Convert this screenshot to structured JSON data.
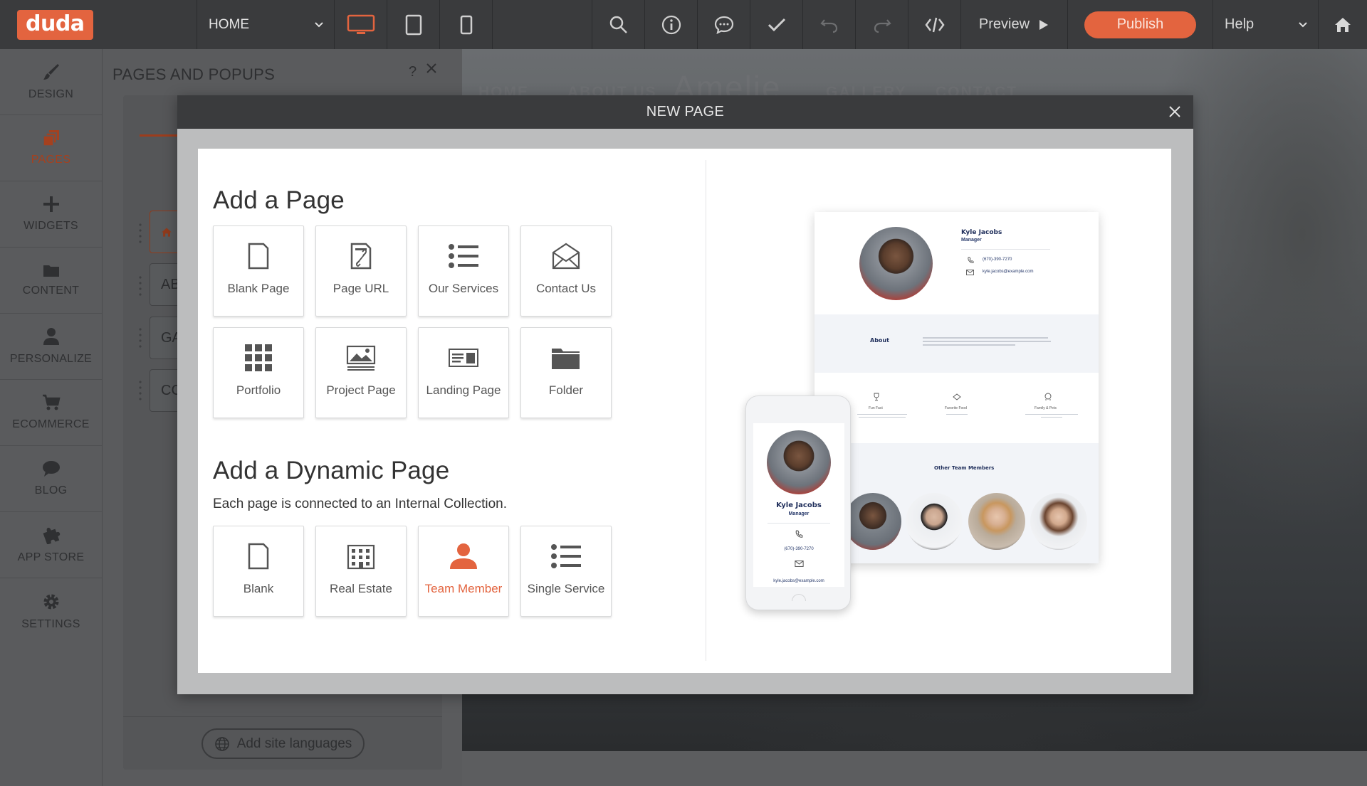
{
  "app": {
    "logo": "duda"
  },
  "topbar": {
    "page_select": "HOME",
    "preview": "Preview",
    "publish": "Publish",
    "help": "Help"
  },
  "sidebar": {
    "items": [
      {
        "label": "DESIGN",
        "icon": "brush-icon"
      },
      {
        "label": "PAGES",
        "icon": "pages-icon",
        "active": true
      },
      {
        "label": "WIDGETS",
        "icon": "plus-icon"
      },
      {
        "label": "CONTENT",
        "icon": "folder-icon"
      },
      {
        "label": "PERSONALIZE",
        "icon": "user-icon"
      },
      {
        "label": "ECOMMERCE",
        "icon": "cart-icon"
      },
      {
        "label": "BLOG",
        "icon": "chat-bubble-icon"
      },
      {
        "label": "APP STORE",
        "icon": "puzzle-icon"
      },
      {
        "label": "SETTINGS",
        "icon": "gear-icon"
      }
    ]
  },
  "pages_panel": {
    "title": "PAGES AND POPUPS",
    "help": "?",
    "rows": [
      "AB",
      "GA",
      "CC"
    ],
    "add_languages": "Add site languages"
  },
  "site": {
    "nav": [
      "HOME",
      "ABOUT US",
      "GALLERY",
      "CONTACT"
    ],
    "brand": "Amelie"
  },
  "modal": {
    "title": "NEW PAGE",
    "add_page": {
      "title": "Add a Page",
      "tiles": [
        "Blank Page",
        "Page URL",
        "Our Services",
        "Contact Us",
        "Portfolio",
        "Project Page",
        "Landing Page",
        "Folder"
      ]
    },
    "add_dynamic": {
      "title": "Add a Dynamic Page",
      "subtitle": "Each page is connected to an Internal Collection.",
      "tiles": [
        "Blank",
        "Real Estate",
        "Team Member",
        "Single Service"
      ]
    },
    "preview": {
      "name": "Kyle Jacobs",
      "role": "Manager",
      "phone": "(670)-390-7270",
      "email": "kyle.jacobs@example.com",
      "about": "About",
      "facts": [
        "Fun Fact",
        "Favorite Food",
        "Family & Pets"
      ],
      "team_heading": "Other Team Members"
    }
  },
  "colors": {
    "accent": "#e3643f",
    "topbar": "#3a3b3d",
    "navy": "#1e2d5a"
  }
}
